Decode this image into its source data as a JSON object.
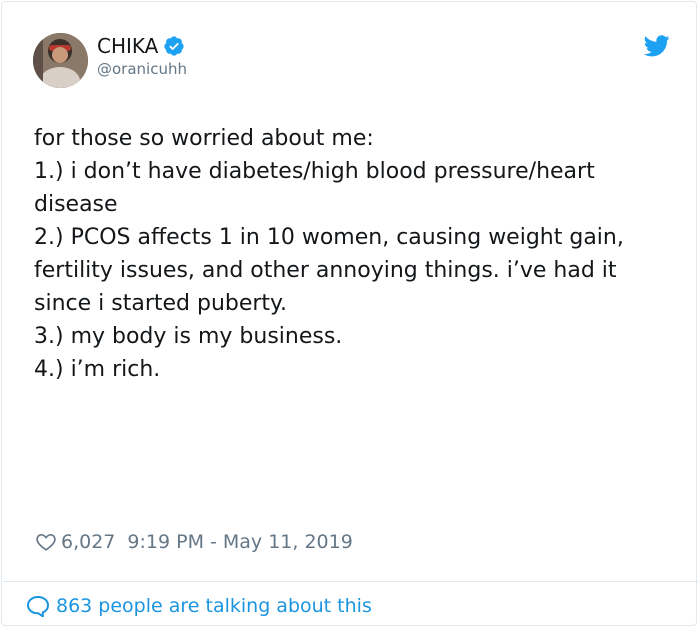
{
  "author": {
    "name": "CHIKA",
    "handle": "@oranicuhh",
    "avatar_icon": "user-avatar",
    "verified_icon": "verified-badge-icon"
  },
  "tweet": {
    "lines": [
      "for those so worried about me:",
      "",
      "1.) i don’t have diabetes/high blood pressure/heart disease",
      "",
      "2.) PCOS affects 1 in 10 women, causing weight gain, fertility issues, and other annoying things. i’ve had it since i started puberty.",
      "",
      "3.) my body is my business.",
      "",
      "4.) i’m rich."
    ]
  },
  "meta": {
    "likes": "6,027",
    "timestamp": "9:19 PM - May 11, 2019"
  },
  "footer": {
    "talking_text": "863 people are talking about this"
  },
  "colors": {
    "twitter_blue": "#1da1f2",
    "link_blue": "#1b95e0",
    "muted": "#657786",
    "text": "#14171a"
  }
}
